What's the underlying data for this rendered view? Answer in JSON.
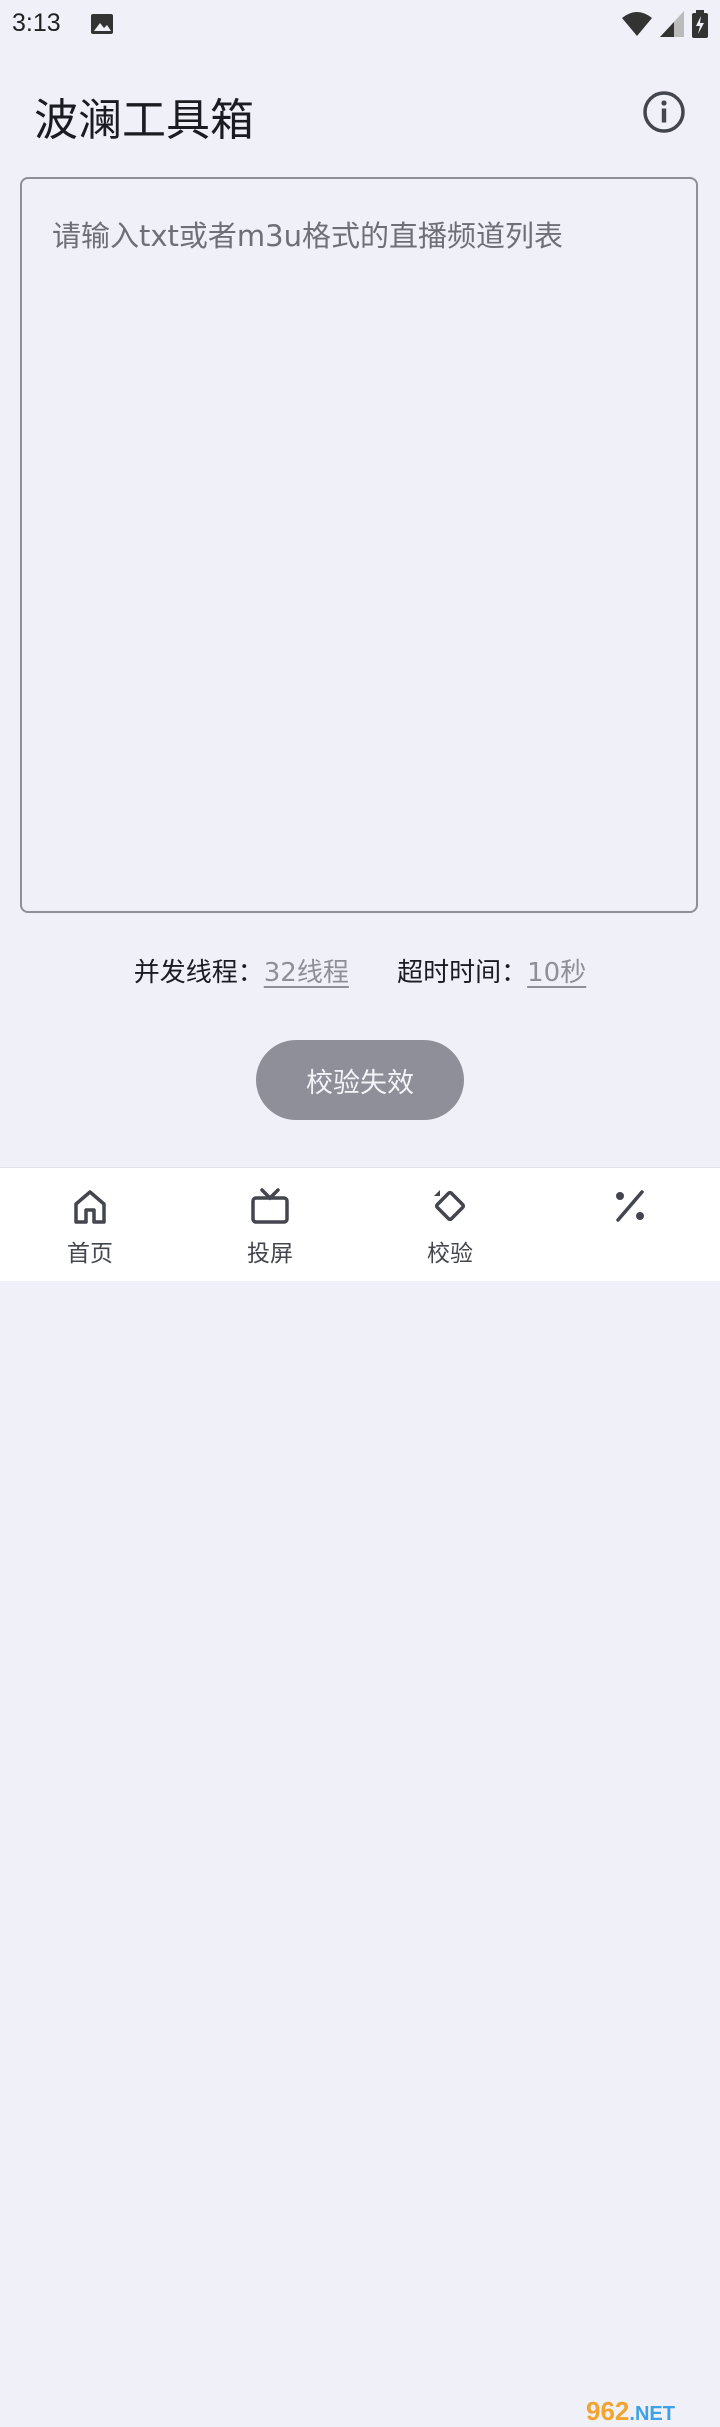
{
  "status_bar": {
    "time": "3:13"
  },
  "header": {
    "title": "波澜工具箱"
  },
  "input": {
    "placeholder": "请输入txt或者m3u格式的直播频道列表"
  },
  "settings": {
    "threads_label": "并发线程：",
    "threads_value": "32线程",
    "timeout_label": "超时时间：",
    "timeout_value": "10秒"
  },
  "action": {
    "validate_label": "校验失效"
  },
  "nav": {
    "items": [
      {
        "label": "首页",
        "icon": "home-icon"
      },
      {
        "label": "投屏",
        "icon": "tv-icon"
      },
      {
        "label": "校验",
        "icon": "rotate-icon"
      },
      {
        "label": "",
        "icon": "percent-icon"
      }
    ]
  },
  "watermark": {
    "num": "962",
    "suffix": ".NET"
  },
  "colors": {
    "background": "#eff0f8",
    "button": "#8e8f99",
    "nav_bg": "#ffffff"
  }
}
